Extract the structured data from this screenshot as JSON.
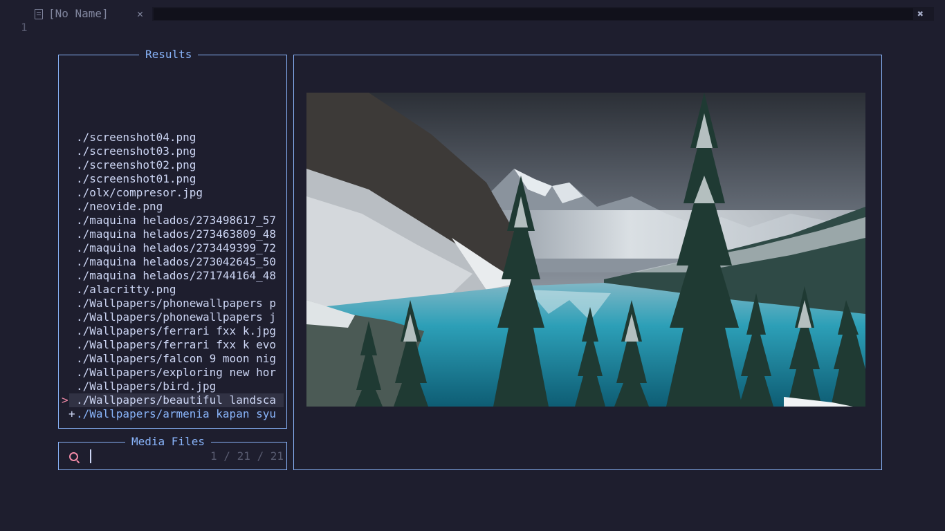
{
  "tab": {
    "name": "[No Name]",
    "close_glyph": "✕",
    "icon": "file-icon"
  },
  "window": {
    "close_glyph": "✖"
  },
  "editor": {
    "line_number": "1"
  },
  "results": {
    "title": "Results",
    "items": [
      {
        "path": "./screenshot04.png"
      },
      {
        "path": "./screenshot03.png"
      },
      {
        "path": "./screenshot02.png"
      },
      {
        "path": "./screenshot01.png"
      },
      {
        "path": "./olx/compresor.jpg"
      },
      {
        "path": "./neovide.png"
      },
      {
        "path": "./maquina helados/273498617_57"
      },
      {
        "path": "./maquina helados/273463809_48"
      },
      {
        "path": "./maquina helados/273449399_72"
      },
      {
        "path": "./maquina helados/273042645_50"
      },
      {
        "path": "./maquina helados/271744164_48"
      },
      {
        "path": "./alacritty.png"
      },
      {
        "path": "./Wallpapers/phonewallpapers p"
      },
      {
        "path": "./Wallpapers/phonewallpapers j"
      },
      {
        "path": "./Wallpapers/ferrari fxx k.jpg"
      },
      {
        "path": "./Wallpapers/ferrari fxx k evo"
      },
      {
        "path": "./Wallpapers/falcon 9 moon nig"
      },
      {
        "path": "./Wallpapers/exploring new hor"
      },
      {
        "path": "./Wallpapers/bird.jpg"
      },
      {
        "path": "./Wallpapers/beautiful landsca",
        "selected": true,
        "caret": ">"
      },
      {
        "path": "./Wallpapers/armenia kapan syu",
        "multi": true,
        "mark": "+"
      }
    ]
  },
  "prompt": {
    "title": "Media Files",
    "value": "",
    "counter": "1 / 21 / 21",
    "icon": "search-icon"
  },
  "preview": {
    "image_subject": "snowy mountain lake with evergreen trees (landscape photo)"
  },
  "colors": {
    "background": "#1e1e2e",
    "border": "#89b4fa",
    "text": "#cdd6f4",
    "muted": "#585b70",
    "caret": "#f38ba8",
    "selection": "#313244"
  }
}
